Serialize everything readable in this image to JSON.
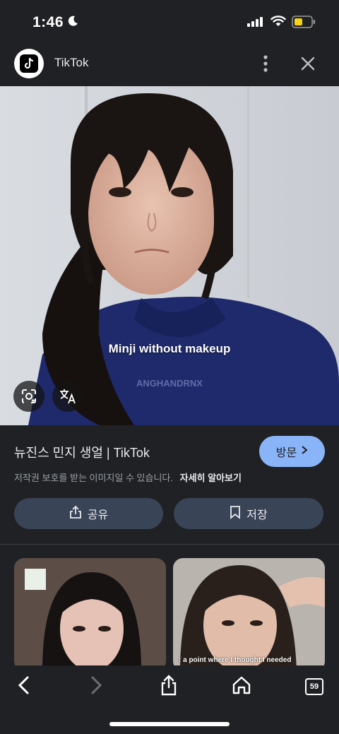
{
  "status_bar": {
    "time": "1:46"
  },
  "header": {
    "title": "TikTok"
  },
  "image": {
    "caption": "Minji without makeup",
    "watermark": "ANGHANDRNX"
  },
  "info": {
    "title": "뉴진스 민지 생얼 | TikTok",
    "visit_label": "방문",
    "copyright": "저작권 보호를 받는 이미지일 수 있습니다.",
    "learn_more": "자세히 알아보기"
  },
  "actions": {
    "share_label": "공유",
    "save_label": "저장"
  },
  "related": [
    {
      "caption": ""
    },
    {
      "caption": ": a point where I thought I needed"
    }
  ],
  "toolbar": {
    "tab_count": "59"
  },
  "colors": {
    "background": "#202124",
    "accent": "#8ab4f8",
    "button": "#394457"
  },
  "icons": [
    "tiktok-logo",
    "moon-icon",
    "signal-icon",
    "wifi-icon",
    "battery-icon",
    "more-vert-icon",
    "close-icon",
    "lens-icon",
    "translate-icon",
    "share-icon",
    "bookmark-icon",
    "back-icon",
    "forward-icon",
    "home-icon",
    "tabs-icon"
  ]
}
